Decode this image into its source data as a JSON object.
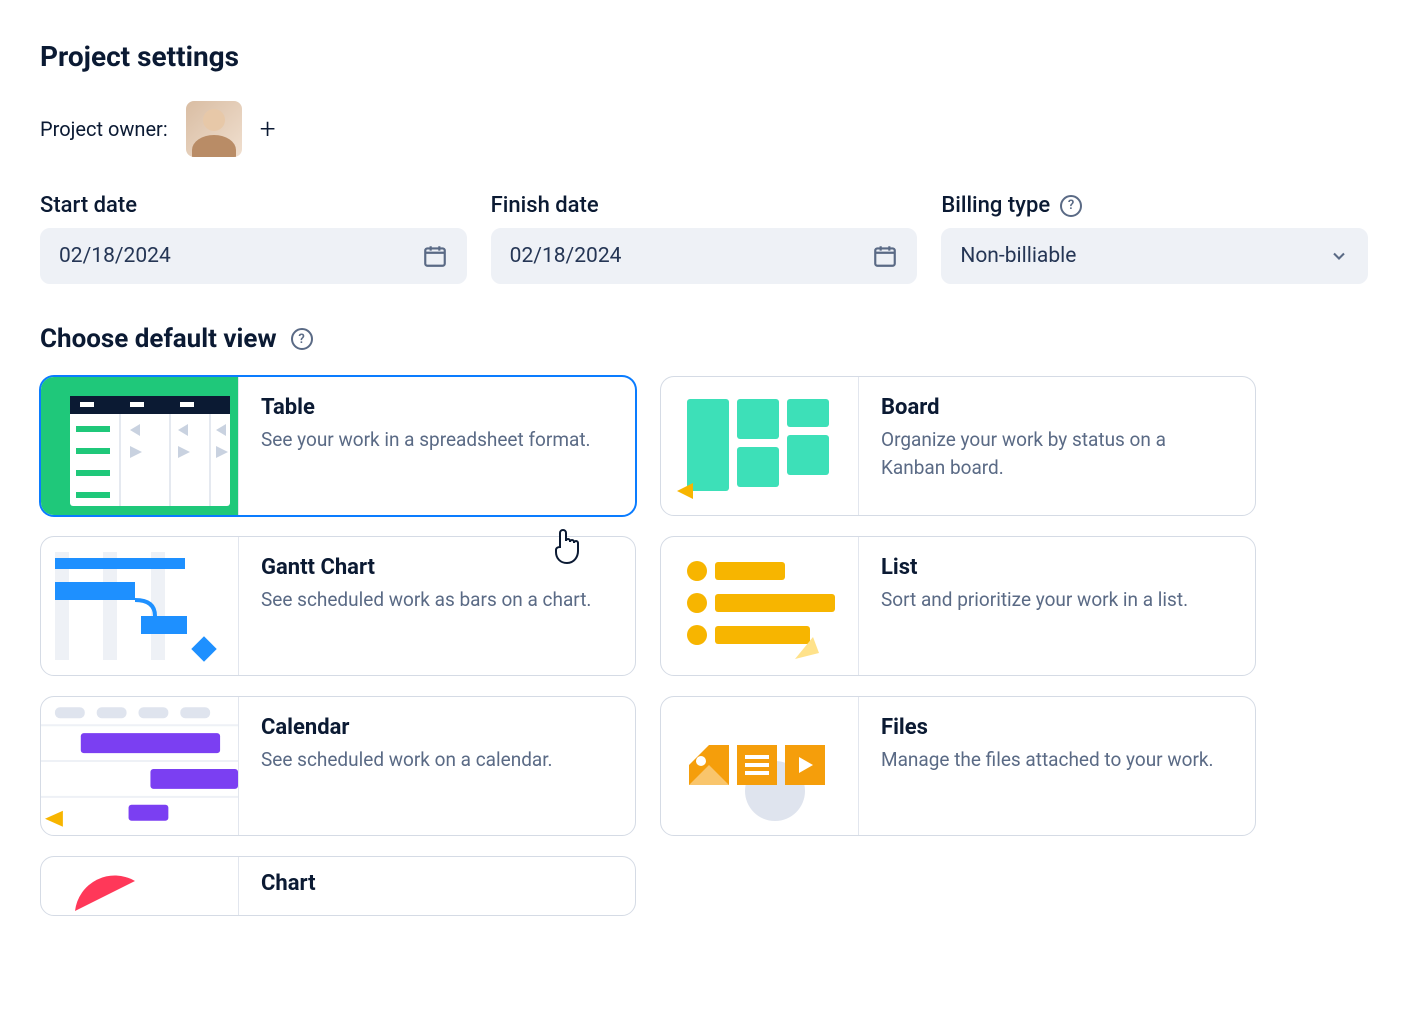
{
  "page_title": "Project settings",
  "owner": {
    "label": "Project owner:"
  },
  "fields": {
    "start_date": {
      "label": "Start date",
      "value": "02/18/2024"
    },
    "finish_date": {
      "label": "Finish date",
      "value": "02/18/2024"
    },
    "billing_type": {
      "label": "Billing type",
      "value": "Non-billiable"
    }
  },
  "default_view_heading": "Choose default view",
  "views": {
    "table": {
      "title": "Table",
      "desc": "See your work in a spreadsheet format."
    },
    "board": {
      "title": "Board",
      "desc": "Organize your work by status on a Kanban board."
    },
    "gantt": {
      "title": "Gantt Chart",
      "desc": "See scheduled work as bars on a chart."
    },
    "list": {
      "title": "List",
      "desc": "Sort and prioritize your work in a list."
    },
    "calendar": {
      "title": "Calendar",
      "desc": "See scheduled work on a calendar."
    },
    "files": {
      "title": "Files",
      "desc": "Manage the files attached to your work."
    },
    "chart": {
      "title": "Chart",
      "desc": ""
    }
  }
}
